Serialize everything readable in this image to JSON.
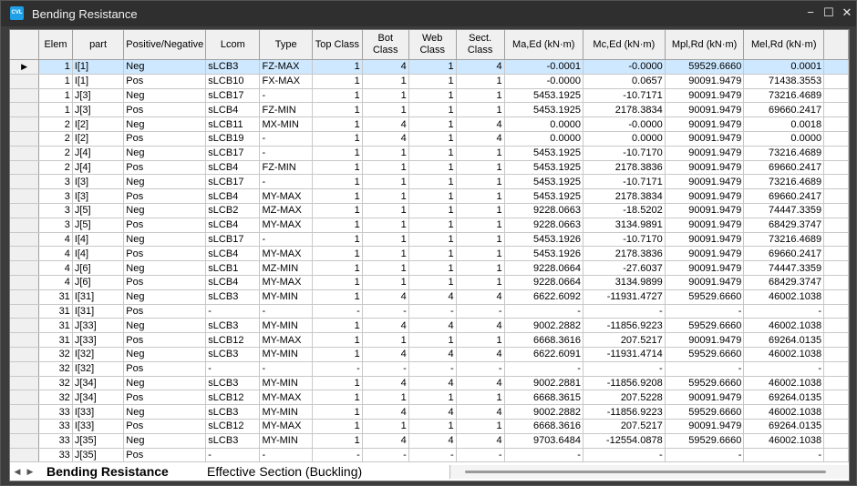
{
  "window": {
    "title": "Bending Resistance",
    "app_icon_text": "CVL"
  },
  "controls": {
    "minimize": "−",
    "maximize": "☐",
    "close": "✕"
  },
  "columns": [
    {
      "key": "elem",
      "label": "Elem",
      "align": "r"
    },
    {
      "key": "part",
      "label": "part",
      "align": "l"
    },
    {
      "key": "pn",
      "label": "Positive/Negative",
      "align": "l"
    },
    {
      "key": "lcom",
      "label": "Lcom",
      "align": "l"
    },
    {
      "key": "type",
      "label": "Type",
      "align": "l"
    },
    {
      "key": "top",
      "label": "Top Class",
      "align": "r"
    },
    {
      "key": "bot",
      "label": "Bot Class",
      "align": "r"
    },
    {
      "key": "web",
      "label": "Web Class",
      "align": "r"
    },
    {
      "key": "sect",
      "label": "Sect. Class",
      "align": "r"
    },
    {
      "key": "ma",
      "label": "Ma,Ed (kN·m)",
      "align": "r"
    },
    {
      "key": "mc",
      "label": "Mc,Ed (kN·m)",
      "align": "r"
    },
    {
      "key": "mpl",
      "label": "Mpl,Rd (kN·m)",
      "align": "r"
    },
    {
      "key": "mel",
      "label": "Mel,Rd (kN·m)",
      "align": "r"
    }
  ],
  "rows": [
    [
      "1",
      "I[1]",
      "Neg",
      "sLCB3",
      "FZ-MAX",
      "1",
      "4",
      "1",
      "4",
      "-0.0001",
      "-0.0000",
      "59529.6660",
      "0.0001"
    ],
    [
      "1",
      "I[1]",
      "Pos",
      "sLCB10",
      "FX-MAX",
      "1",
      "1",
      "1",
      "1",
      "-0.0000",
      "0.0657",
      "90091.9479",
      "71438.3553"
    ],
    [
      "1",
      "J[3]",
      "Neg",
      "sLCB17",
      "-",
      "1",
      "1",
      "1",
      "1",
      "5453.1925",
      "-10.7171",
      "90091.9479",
      "73216.4689"
    ],
    [
      "1",
      "J[3]",
      "Pos",
      "sLCB4",
      "FZ-MIN",
      "1",
      "1",
      "1",
      "1",
      "5453.1925",
      "2178.3834",
      "90091.9479",
      "69660.2417"
    ],
    [
      "2",
      "I[2]",
      "Neg",
      "sLCB11",
      "MX-MIN",
      "1",
      "4",
      "1",
      "4",
      "0.0000",
      "-0.0000",
      "90091.9479",
      "0.0018"
    ],
    [
      "2",
      "I[2]",
      "Pos",
      "sLCB19",
      "-",
      "1",
      "4",
      "1",
      "4",
      "0.0000",
      "0.0000",
      "90091.9479",
      "0.0000"
    ],
    [
      "2",
      "J[4]",
      "Neg",
      "sLCB17",
      "-",
      "1",
      "1",
      "1",
      "1",
      "5453.1925",
      "-10.7170",
      "90091.9479",
      "73216.4689"
    ],
    [
      "2",
      "J[4]",
      "Pos",
      "sLCB4",
      "FZ-MIN",
      "1",
      "1",
      "1",
      "1",
      "5453.1925",
      "2178.3836",
      "90091.9479",
      "69660.2417"
    ],
    [
      "3",
      "I[3]",
      "Neg",
      "sLCB17",
      "-",
      "1",
      "1",
      "1",
      "1",
      "5453.1925",
      "-10.7171",
      "90091.9479",
      "73216.4689"
    ],
    [
      "3",
      "I[3]",
      "Pos",
      "sLCB4",
      "MY-MAX",
      "1",
      "1",
      "1",
      "1",
      "5453.1925",
      "2178.3834",
      "90091.9479",
      "69660.2417"
    ],
    [
      "3",
      "J[5]",
      "Neg",
      "sLCB2",
      "MZ-MAX",
      "1",
      "1",
      "1",
      "1",
      "9228.0663",
      "-18.5202",
      "90091.9479",
      "74447.3359"
    ],
    [
      "3",
      "J[5]",
      "Pos",
      "sLCB4",
      "MY-MAX",
      "1",
      "1",
      "1",
      "1",
      "9228.0663",
      "3134.9891",
      "90091.9479",
      "68429.3747"
    ],
    [
      "4",
      "I[4]",
      "Neg",
      "sLCB17",
      "-",
      "1",
      "1",
      "1",
      "1",
      "5453.1926",
      "-10.7170",
      "90091.9479",
      "73216.4689"
    ],
    [
      "4",
      "I[4]",
      "Pos",
      "sLCB4",
      "MY-MAX",
      "1",
      "1",
      "1",
      "1",
      "5453.1926",
      "2178.3836",
      "90091.9479",
      "69660.2417"
    ],
    [
      "4",
      "J[6]",
      "Neg",
      "sLCB1",
      "MZ-MIN",
      "1",
      "1",
      "1",
      "1",
      "9228.0664",
      "-27.6037",
      "90091.9479",
      "74447.3359"
    ],
    [
      "4",
      "J[6]",
      "Pos",
      "sLCB4",
      "MY-MAX",
      "1",
      "1",
      "1",
      "1",
      "9228.0664",
      "3134.9899",
      "90091.9479",
      "68429.3747"
    ],
    [
      "31",
      "I[31]",
      "Neg",
      "sLCB3",
      "MY-MIN",
      "1",
      "4",
      "4",
      "4",
      "6622.6092",
      "-11931.4727",
      "59529.6660",
      "46002.1038"
    ],
    [
      "31",
      "I[31]",
      "Pos",
      "-",
      "-",
      "-",
      "-",
      "-",
      "-",
      "-",
      "-",
      "-",
      "-"
    ],
    [
      "31",
      "J[33]",
      "Neg",
      "sLCB3",
      "MY-MIN",
      "1",
      "4",
      "4",
      "4",
      "9002.2882",
      "-11856.9223",
      "59529.6660",
      "46002.1038"
    ],
    [
      "31",
      "J[33]",
      "Pos",
      "sLCB12",
      "MY-MAX",
      "1",
      "1",
      "1",
      "1",
      "6668.3616",
      "207.5217",
      "90091.9479",
      "69264.0135"
    ],
    [
      "32",
      "I[32]",
      "Neg",
      "sLCB3",
      "MY-MIN",
      "1",
      "4",
      "4",
      "4",
      "6622.6091",
      "-11931.4714",
      "59529.6660",
      "46002.1038"
    ],
    [
      "32",
      "I[32]",
      "Pos",
      "-",
      "-",
      "-",
      "-",
      "-",
      "-",
      "-",
      "-",
      "-",
      "-"
    ],
    [
      "32",
      "J[34]",
      "Neg",
      "sLCB3",
      "MY-MIN",
      "1",
      "4",
      "4",
      "4",
      "9002.2881",
      "-11856.9208",
      "59529.6660",
      "46002.1038"
    ],
    [
      "32",
      "J[34]",
      "Pos",
      "sLCB12",
      "MY-MAX",
      "1",
      "1",
      "1",
      "1",
      "6668.3615",
      "207.5228",
      "90091.9479",
      "69264.0135"
    ],
    [
      "33",
      "I[33]",
      "Neg",
      "sLCB3",
      "MY-MIN",
      "1",
      "4",
      "4",
      "4",
      "9002.2882",
      "-11856.9223",
      "59529.6660",
      "46002.1038"
    ],
    [
      "33",
      "I[33]",
      "Pos",
      "sLCB12",
      "MY-MAX",
      "1",
      "1",
      "1",
      "1",
      "6668.3616",
      "207.5217",
      "90091.9479",
      "69264.0135"
    ],
    [
      "33",
      "J[35]",
      "Neg",
      "sLCB3",
      "MY-MIN",
      "1",
      "4",
      "4",
      "4",
      "9703.6484",
      "-12554.0878",
      "59529.6660",
      "46002.1038"
    ],
    [
      "33",
      "J[35]",
      "Pos",
      "-",
      "-",
      "-",
      "-",
      "-",
      "-",
      "-",
      "-",
      "-",
      "-"
    ]
  ],
  "selected_row": 0,
  "current_row_marker": "▶",
  "tabs": [
    {
      "label": "Bending Resistance",
      "active": true
    },
    {
      "label": "Effective Section (Buckling)",
      "active": false
    }
  ],
  "tab_nav": {
    "prev": "◀",
    "next": "▶"
  },
  "colors": {
    "selection": "#cde8ff",
    "title_bar": "#2f2f2f",
    "app_icon": "#1ea0e8"
  }
}
